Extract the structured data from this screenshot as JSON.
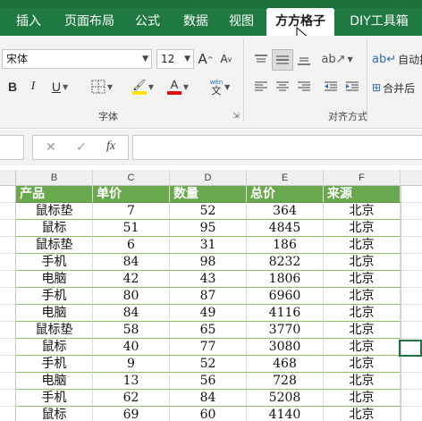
{
  "ribbon": {
    "tabs": [
      {
        "label": "插入",
        "active": false
      },
      {
        "label": "页面布局",
        "active": false
      },
      {
        "label": "公式",
        "active": false
      },
      {
        "label": "数据",
        "active": false
      },
      {
        "label": "视图",
        "active": false
      },
      {
        "label": "方方格子",
        "active": true
      },
      {
        "label": "DIY工具箱",
        "active": false
      }
    ],
    "font": {
      "name": "宋体",
      "size": "12",
      "grow": "A",
      "shrink": "A",
      "bold": "B",
      "italic": "I",
      "underline": "U",
      "fill_letter": "A",
      "fontcolor_letter": "A",
      "phonetic": "wén",
      "phonetic_char": "文",
      "group_label": "字体"
    },
    "align": {
      "wrap_label": "自动换",
      "merge_label": "合并后",
      "group_label": "对齐方式"
    },
    "colors": {
      "fill_bar": "#ffe500",
      "fontcolor_bar": "#e01010",
      "tab_bg": "#1f7a42",
      "header_fill": "#69a84d"
    }
  },
  "formula_bar": {
    "cancel_icon": "✕",
    "enter_icon": "✓",
    "fx_label": "fx"
  },
  "sheet": {
    "columns": [
      "B",
      "C",
      "D",
      "E",
      "F"
    ],
    "header": [
      "产品",
      "单价",
      "数量",
      "总价",
      "来源"
    ],
    "rows": [
      [
        "鼠标垫",
        "7",
        "52",
        "364",
        "北京"
      ],
      [
        "鼠标",
        "51",
        "95",
        "4845",
        "北京"
      ],
      [
        "鼠标垫",
        "6",
        "31",
        "186",
        "北京"
      ],
      [
        "手机",
        "84",
        "98",
        "8232",
        "北京"
      ],
      [
        "电脑",
        "42",
        "43",
        "1806",
        "北京"
      ],
      [
        "手机",
        "80",
        "87",
        "6960",
        "北京"
      ],
      [
        "电脑",
        "84",
        "49",
        "4116",
        "北京"
      ],
      [
        "鼠标垫",
        "58",
        "65",
        "3770",
        "北京"
      ],
      [
        "鼠标",
        "40",
        "77",
        "3080",
        "北京"
      ],
      [
        "手机",
        "9",
        "52",
        "468",
        "北京"
      ],
      [
        "电脑",
        "13",
        "56",
        "728",
        "北京"
      ],
      [
        "手机",
        "62",
        "84",
        "5208",
        "北京"
      ],
      [
        "鼠标",
        "69",
        "60",
        "4140",
        "北京"
      ]
    ]
  }
}
